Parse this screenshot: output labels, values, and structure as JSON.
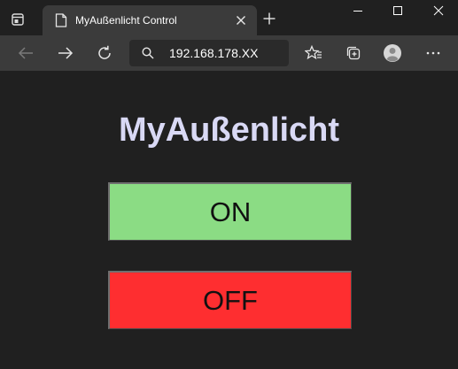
{
  "tab": {
    "title": "MyAußenlicht Control"
  },
  "address_bar": {
    "url": "192.168.178.XX"
  },
  "page": {
    "title": "MyAußenlicht",
    "on_label": "ON",
    "off_label": "OFF"
  },
  "colors": {
    "on_button": "#8bdc84",
    "off_button": "#fe2e30",
    "title_text": "#d9d9f5",
    "background": "#202020"
  },
  "icons": {
    "tab_actions": "tab-actions-icon",
    "favicon": "page-icon",
    "tab_close": "close-icon",
    "new_tab": "plus-icon",
    "minimize": "minimize-icon",
    "maximize": "maximize-icon",
    "window_close": "close-icon",
    "back": "back-arrow-icon",
    "forward": "forward-arrow-icon",
    "refresh": "refresh-icon",
    "search": "search-icon",
    "favorites": "favorites-star-icon",
    "collections": "collections-icon",
    "profile": "profile-avatar-icon",
    "more": "more-ellipsis-icon"
  }
}
